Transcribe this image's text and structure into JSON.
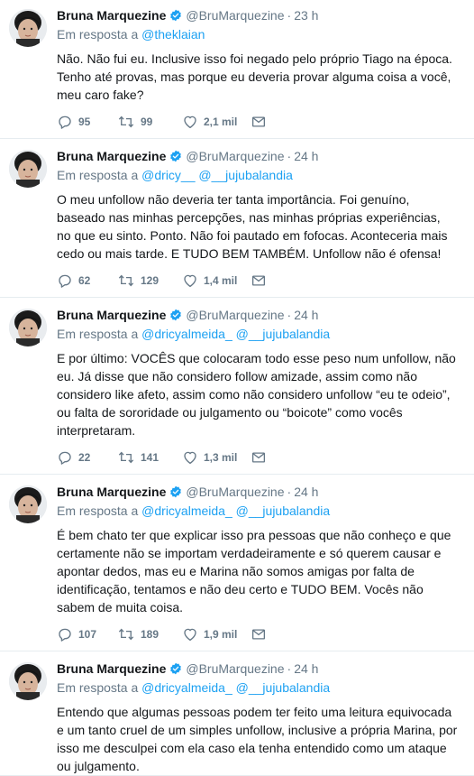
{
  "colors": {
    "link": "#1da1f2",
    "muted": "#657786",
    "text": "#14171a",
    "divider": "#e6ecf0",
    "verified": "#1da1f2"
  },
  "icons": {
    "reply": "speech-bubble-icon",
    "retweet": "retweet-arrows-icon",
    "like": "heart-outline-icon",
    "dm": "envelope-icon",
    "verified": "verified-badge-icon"
  },
  "tweets": [
    {
      "name": "Bruna Marquezine",
      "handle": "@BruMarquezine",
      "time": "23 h",
      "reply_prefix": "Em resposta a",
      "mentions": [
        "@theklaian"
      ],
      "text": "Não. Não fui eu. Inclusive isso foi negado pelo próprio Tiago na época. Tenho até provas, mas porque eu deveria provar alguma coisa a você, meu caro fake?",
      "replies": "95",
      "retweets": "99",
      "likes": "2,1 mil"
    },
    {
      "name": "Bruna Marquezine",
      "handle": "@BruMarquezine",
      "time": "24 h",
      "reply_prefix": "Em resposta a",
      "mentions": [
        "@dricy__",
        "@__jujubalandia"
      ],
      "text": "O meu unfollow não deveria ter tanta importância. Foi genuíno, baseado nas minhas percepções, nas minhas próprias experiências, no que eu sinto. Ponto. Não foi pautado em fofocas. Aconteceria mais cedo ou mais tarde. E TUDO BEM TAMBÉM. Unfollow não é ofensa!",
      "replies": "62",
      "retweets": "129",
      "likes": "1,4 mil"
    },
    {
      "name": "Bruna Marquezine",
      "handle": "@BruMarquezine",
      "time": "24 h",
      "reply_prefix": "Em resposta a",
      "mentions": [
        "@dricyalmeida_",
        "@__jujubalandia"
      ],
      "text": "E por último: VOCÊS que colocaram todo esse peso num unfollow, não eu. Já disse que não considero follow amizade, assim como não considero like afeto, assim como não considero unfollow “eu te odeio”, ou falta de sororidade ou julgamento ou “boicote” como vocês interpretaram.",
      "replies": "22",
      "retweets": "141",
      "likes": "1,3 mil"
    },
    {
      "name": "Bruna Marquezine",
      "handle": "@BruMarquezine",
      "time": "24 h",
      "reply_prefix": "Em resposta a",
      "mentions": [
        "@dricyalmeida_",
        "@__jujubalandia"
      ],
      "text": "É bem chato ter que explicar isso pra pessoas que não conheço e que certamente não se importam verdadeiramente e só querem causar e apontar dedos, mas eu e Marina não somos amigas por falta de identificação, tentamos e não deu certo e TUDO BEM. Vocês não sabem de muita coisa.",
      "replies": "107",
      "retweets": "189",
      "likes": "1,9 mil"
    },
    {
      "name": "Bruna Marquezine",
      "handle": "@BruMarquezine",
      "time": "24 h",
      "reply_prefix": "Em resposta a",
      "mentions": [
        "@dricyalmeida_",
        "@__jujubalandia"
      ],
      "text": "Entendo que algumas pessoas podem ter feito uma leitura equivocada e um tanto cruel de um simples unfollow, inclusive a própria Marina, por isso me desculpei com ela caso ela tenha entendido como um ataque ou julgamento.",
      "replies": "",
      "retweets": "",
      "likes": ""
    }
  ]
}
